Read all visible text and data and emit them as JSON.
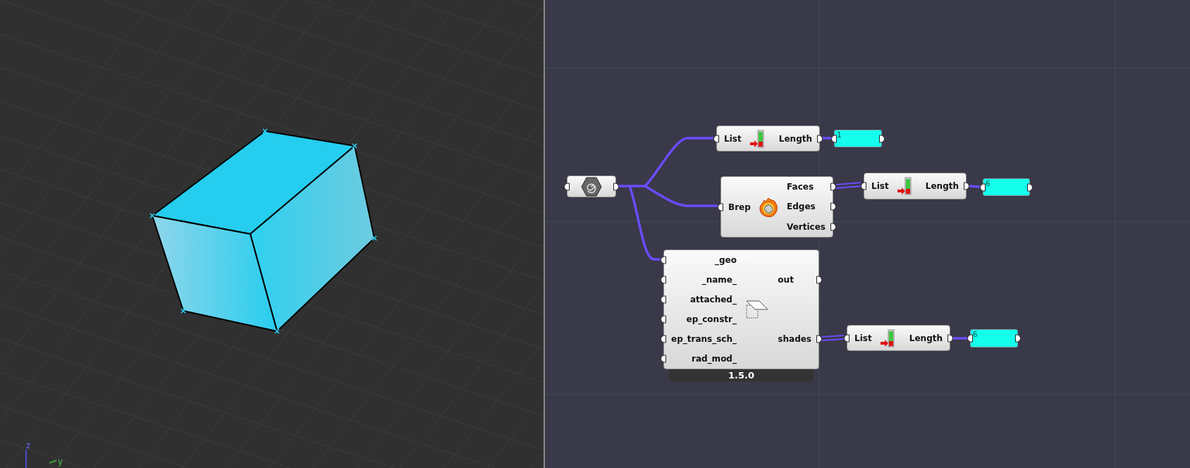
{
  "viewport": {
    "axes": [
      {
        "label": "z",
        "kind": "z"
      },
      {
        "label": "y",
        "kind": "y"
      }
    ]
  },
  "canvas": {
    "nodes": [
      {
        "kind": "geometry_param"
      },
      {
        "kind": "list_length",
        "inputs": [
          "List"
        ],
        "outputs": [
          "Length"
        ]
      },
      {
        "kind": "panel",
        "value": "1"
      },
      {
        "kind": "deconstruct_brep",
        "inputs": [
          "Brep"
        ],
        "outputs": [
          "Faces",
          "Edges",
          "Vertices"
        ]
      },
      {
        "kind": "list_length",
        "inputs": [
          "List"
        ],
        "outputs": [
          "Length"
        ]
      },
      {
        "kind": "panel",
        "value": "6"
      },
      {
        "kind": "shade_component",
        "inputs": [
          "_geo",
          "_name_",
          "attached_",
          "ep_constr_",
          "ep_trans_sch_",
          "rad_mod_"
        ],
        "outputs": [
          "out",
          "shades"
        ],
        "version": "1.5.0"
      },
      {
        "kind": "list_length",
        "inputs": [
          "List"
        ],
        "outputs": [
          "Length"
        ]
      },
      {
        "kind": "panel",
        "value": "6"
      }
    ]
  }
}
